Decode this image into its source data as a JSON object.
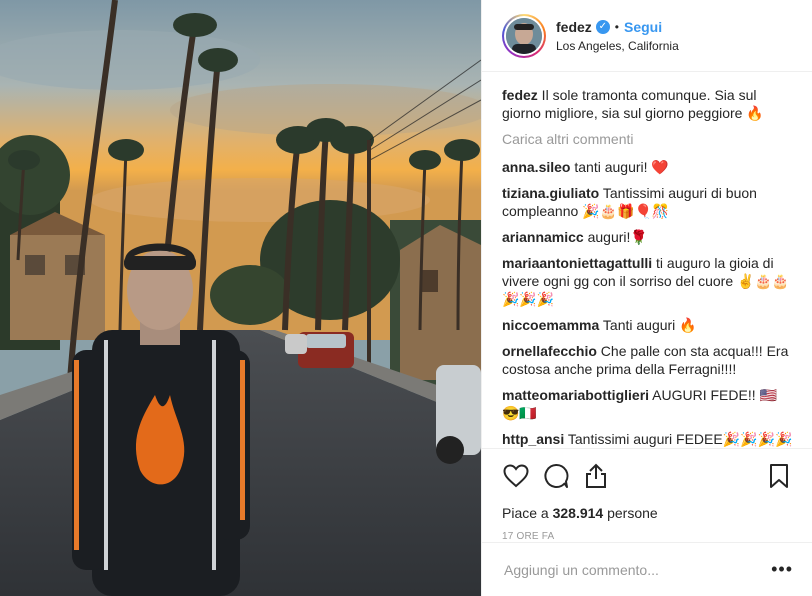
{
  "post": {
    "username": "fedez",
    "verified_icon": "verified-badge-icon",
    "separator": "•",
    "follow_label": "Segui",
    "location": "Los Angeles, California"
  },
  "comments": [
    {
      "user": "fedez",
      "text": " Il sole tramonta comunque. Sia sul giorno migliore, sia sul giorno peggiore 🔥"
    },
    {
      "load_more": "Carica altri commenti"
    },
    {
      "user": "anna.sileo",
      "text": " tanti auguri! ❤️"
    },
    {
      "user": "tiziana.giuliato",
      "text": " Tantissimi auguri di buon compleanno 🎉🎂🎁🎈🎊"
    },
    {
      "user": "ariannamicc",
      "text": " auguri!🌹"
    },
    {
      "user": "mariaantoniettagattulli",
      "text": " ti auguro la gioia di vivere ogni gg con il sorriso del cuore ✌️🎂🎂🎉🎉🎉"
    },
    {
      "user": "niccoemamma",
      "text": " Tanti auguri 🔥"
    },
    {
      "user": "ornellafecchio",
      "text": " Che palle con sta acqua!!! Era costosa anche prima della Ferragni!!!!"
    },
    {
      "user": "matteomariabottiglieri",
      "text": " AUGURI FEDE!! 🇺🇸😎🇮🇹"
    },
    {
      "user": "http_ansi",
      "text": " Tantissimi auguri FEDEE🎉🎉🎉🎉🎉🎉😍❤️"
    }
  ],
  "actions": {
    "like_icon": "heart-icon",
    "comment_icon": "comment-icon",
    "share_icon": "share-icon",
    "save_icon": "bookmark-icon"
  },
  "likes": {
    "prefix": "Piace a ",
    "count": "328.914",
    "suffix": " persone"
  },
  "timestamp": "17 ORE FA",
  "add_comment": {
    "placeholder": "Aggiungi un commento...",
    "more": "•••"
  },
  "colors": {
    "accent": "#3897f0",
    "text": "#262626",
    "muted": "#999999"
  }
}
